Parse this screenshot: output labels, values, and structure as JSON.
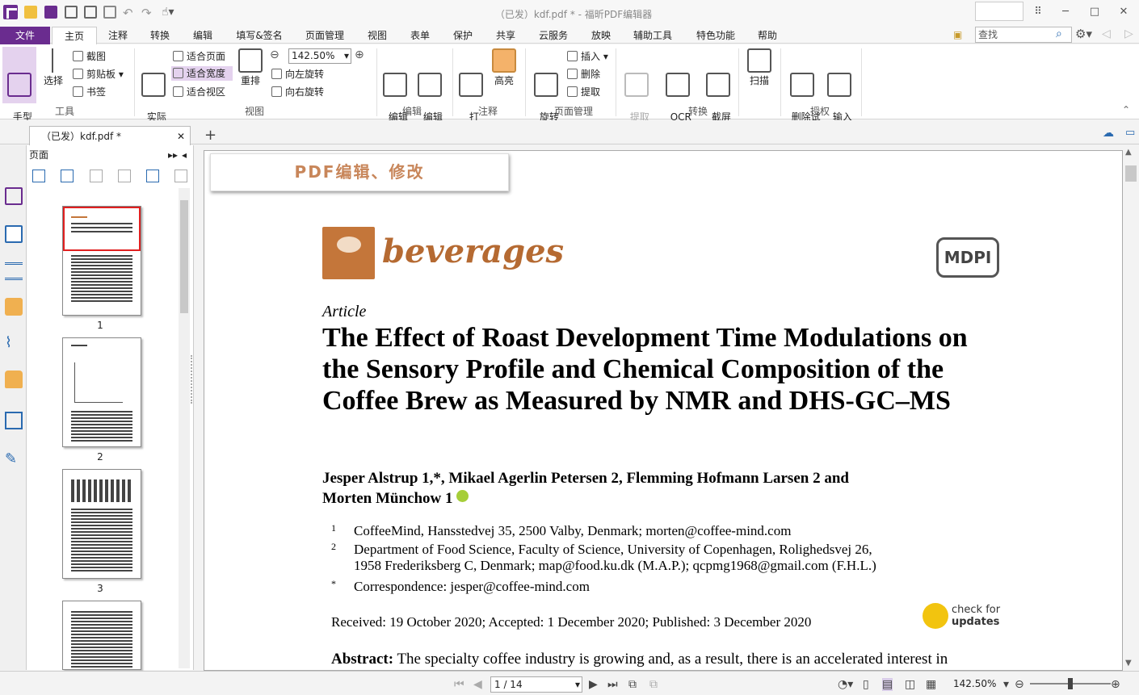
{
  "window": {
    "title": "（已发）kdf.pdf * - 福昕PDF编辑器"
  },
  "menu": {
    "file": "文件",
    "home": "主页",
    "comment": "注释",
    "convert": "转换",
    "edit": "编辑",
    "fill_sign": "填写&签名",
    "page_mgmt": "页面管理",
    "view": "视图",
    "form": "表单",
    "protect": "保护",
    "share": "共享",
    "cloud": "云服务",
    "present": "放映",
    "tools": "辅助工具",
    "features": "特色功能",
    "help": "帮助"
  },
  "search": {
    "placeholder": "查找"
  },
  "ribbon": {
    "hand": "手型\n工具",
    "select": "选择",
    "snapshot": "截图",
    "clipboard": "剪贴板",
    "bookmark": "书签",
    "group_tools": "工具",
    "actual_size": "实际\n大小",
    "fit_page": "适合页面",
    "fit_width": "适合宽度",
    "fit_visible": "适合视区",
    "reflow": "重排",
    "zoom_value": "142.50%",
    "rotate_left": "向左旋转",
    "rotate_right": "向右旋转",
    "group_view": "视图",
    "edit_text": "编辑\n文本",
    "edit_object": "编辑\n对象",
    "group_edit": "编辑",
    "typewriter": "打\n字机",
    "highlight": "高亮",
    "group_comment": "注释",
    "rotate_page": "旋转\n页面",
    "insert": "插入",
    "delete": "删除",
    "extract": "提取",
    "group_page": "页面管理",
    "extract_text": "提取\n文字",
    "ocr": "OCR\n识别文本",
    "screen_ocr": "截屏\n识别",
    "group_convert": "转换",
    "scan": "扫描",
    "remove_watermark": "删除试\n用水印",
    "activate": "输入\n激活码",
    "group_license": "授权"
  },
  "doc_tab": {
    "label": "（已发）kdf.pdf *"
  },
  "panel": {
    "title": "页面",
    "pages": [
      "1",
      "2",
      "3"
    ]
  },
  "banner": {
    "text": "PDF编辑、修改"
  },
  "paper": {
    "journal": "beverages",
    "publisher": "MDPI",
    "type": "Article",
    "title": "The Effect of Roast Development Time Modulations on the Sensory Profile and Chemical Composition of the Coffee Brew as Measured by NMR and DHS-GC–MS",
    "authors_line1": "Jesper Alstrup 1,*, Mikael Agerlin Petersen 2, Flemming Hofmann Larsen 2 and",
    "authors_line2": "Morten Münchow 1",
    "aff1_mark": "1",
    "aff1": "CoffeeMind, Hansstedvej 35, 2500 Valby, Denmark; morten@coffee-mind.com",
    "aff2_mark": "2",
    "aff2a": "Department of Food Science, Faculty of Science, University of Copenhagen, Rolighedsvej 26,",
    "aff2b": "1958 Frederiksberg C, Denmark; map@food.ku.dk (M.A.P.); qcpmg1968@gmail.com (F.H.L.)",
    "corr_mark": "*",
    "corr": "Correspondence: jesper@coffee-mind.com",
    "dates": "Received: 19 October 2020; Accepted: 1 December 2020; Published: 3 December 2020",
    "check1": "check for",
    "check2": "updates",
    "abstract_label": "Abstract:",
    "abstract": " The specialty coffee industry is growing and, as a result, there is an accelerated interest in"
  },
  "status": {
    "page": "1 / 14",
    "zoom": "142.50%"
  }
}
